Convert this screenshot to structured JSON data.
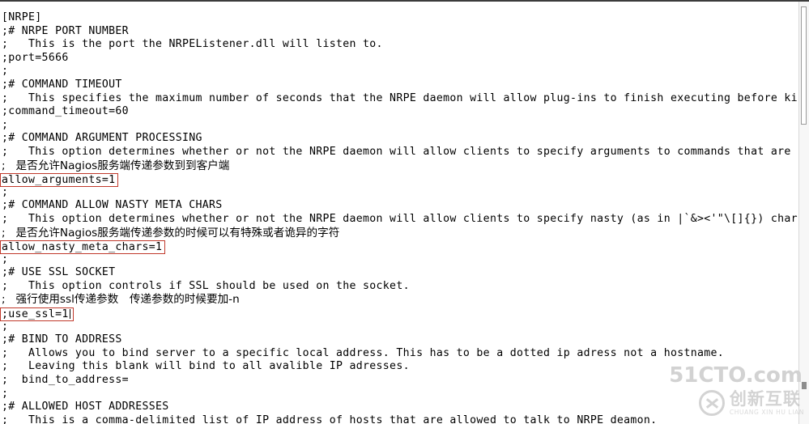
{
  "window": {
    "app": "text-editor",
    "background_color": "#ffffff",
    "text_color": "#000000",
    "highlight_box_color": "#c0392b"
  },
  "document": {
    "section_header": "[NRPE]",
    "lines": [
      {
        "text": "[NRPE]",
        "type": "section"
      },
      {
        "text": ";# NRPE PORT NUMBER",
        "type": "comment-header"
      },
      {
        "text": ";   This is the port the NRPEListener.dll will listen to.",
        "type": "comment"
      },
      {
        "text": ";port=5666",
        "type": "directive-commented"
      },
      {
        "text": ";",
        "type": "comment"
      },
      {
        "text": ";# COMMAND TIMEOUT",
        "type": "comment-header"
      },
      {
        "text": ";   This specifies the maximum number of seconds that the NRPE daemon will allow plug-ins to finish executing before killing t",
        "type": "comment",
        "clipped": true
      },
      {
        "text": ";command_timeout=60",
        "type": "directive-commented"
      },
      {
        "text": ";",
        "type": "comment"
      },
      {
        "text": ";# COMMAND ARGUMENT PROCESSING",
        "type": "comment-header"
      },
      {
        "text": ";   This option determines whether or not the NRPE daemon will allow clients to specify arguments to commands that are execute",
        "type": "comment",
        "clipped": true
      },
      {
        "text": ";   是否允许Nagios服务端传递参数到到客户端",
        "type": "comment-cjk",
        "cjk": true
      },
      {
        "text": "allow_arguments=1",
        "type": "directive",
        "boxed": true
      },
      {
        "text": ";",
        "type": "comment"
      },
      {
        "text": ";# COMMAND ALLOW NASTY META CHARS",
        "type": "comment-header"
      },
      {
        "text": ";   This option determines whether or not the NRPE daemon will allow clients to specify nasty (as in |`&><'\"\\[]{}) characters",
        "type": "comment",
        "clipped": true
      },
      {
        "text": ";   是否允许Nagios服务端传递参数的时候可以有特殊或者诡异的字符",
        "type": "comment-cjk",
        "cjk": true
      },
      {
        "text": "allow_nasty_meta_chars=1",
        "type": "directive",
        "boxed": true
      },
      {
        "text": ";",
        "type": "comment"
      },
      {
        "text": ";# USE SSL SOCKET",
        "type": "comment-header"
      },
      {
        "text": ";   This option controls if SSL should be used on the socket.",
        "type": "comment"
      },
      {
        "text": ";   强行使用ssl传递参数　传递参数的时候要加-n",
        "type": "comment-cjk",
        "cjk": true
      },
      {
        "text": ";use_ssl=1",
        "type": "directive-commented",
        "boxed": true,
        "caret": true
      },
      {
        "text": ";",
        "type": "comment"
      },
      {
        "text": ";# BIND TO ADDRESS",
        "type": "comment-header"
      },
      {
        "text": ";   Allows you to bind server to a specific local address. This has to be a dotted ip adress not a hostname.",
        "type": "comment"
      },
      {
        "text": ";   Leaving this blank will bind to all avalible IP adresses.",
        "type": "comment"
      },
      {
        "text": ";  bind_to_address=",
        "type": "directive-commented"
      },
      {
        "text": ";",
        "type": "comment"
      },
      {
        "text": ";# ALLOWED HOST ADDRESSES",
        "type": "comment-header"
      },
      {
        "text": ";   This is a comma-delimited list of IP address of hosts that are allowed to talk to NRPE deamon.",
        "type": "comment"
      }
    ]
  },
  "scrollbar": {
    "orientation": "vertical",
    "position": "right"
  },
  "watermarks": {
    "site": "51CTO.com",
    "logo_cn": "创新互联",
    "logo_pinyin": "CHUANG XIN HU LIAN"
  }
}
